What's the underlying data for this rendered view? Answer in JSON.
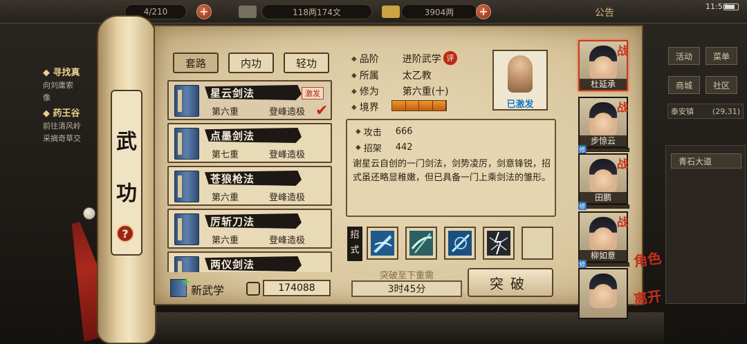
{
  "top_bar": {
    "gold_text": "118两174文",
    "silver_text": "3904两",
    "notice_label": "公告",
    "clock": "11:58",
    "stamina_text": "4/210"
  },
  "quests": [
    {
      "title": "寻找真",
      "lines": [
        "向刘庸索",
        "像"
      ]
    },
    {
      "title": "药王谷",
      "lines": [
        "前往清风岭",
        "采摘奇草交"
      ]
    }
  ],
  "side_menu": {
    "activity": "活动",
    "menu": "菜单",
    "mall": "商城",
    "community": "社区",
    "location": "泰安镇",
    "coords": "(29,31)",
    "road": "青石大道"
  },
  "scroll": {
    "title_char_1": "武",
    "title_char_2": "功",
    "help": "?"
  },
  "tabs": [
    {
      "label": "套路",
      "active": true
    },
    {
      "label": "内功",
      "active": false
    },
    {
      "label": "轻功",
      "active": false
    }
  ],
  "skills": [
    {
      "name": "星云剑法",
      "level": "第六重",
      "grade": "登峰造极",
      "badge": "激发",
      "selected": true
    },
    {
      "name": "点墨剑法",
      "level": "第七重",
      "grade": "登峰造极",
      "badge": "",
      "selected": false
    },
    {
      "name": "苍狼枪法",
      "level": "第六重",
      "grade": "登峰造极",
      "badge": "",
      "selected": false
    },
    {
      "name": "厉斩刀法",
      "level": "第六重",
      "grade": "登峰造极",
      "badge": "",
      "selected": false
    },
    {
      "name": "两仪剑法",
      "level": "",
      "grade": "",
      "badge": "",
      "selected": false
    }
  ],
  "bottom_left": {
    "new_skill": "新武学",
    "points": "174088"
  },
  "detail": {
    "grade_label": "品阶",
    "grade_value": "进阶武学",
    "grade_badge": "评",
    "sect_label": "所属",
    "sect_value": "太乙教",
    "level_label": "修为",
    "level_value": "第六重(十)",
    "realm_label": "境界",
    "realm_segments": 4,
    "status": "已激发",
    "attack_label": "攻击",
    "attack_value": "666",
    "parry_label": "招架",
    "parry_value": "442",
    "description": "谢星云自创的一门剑法，剑势凌厉，剑意锋锐，招式虽还略显稚嫩，但已具备一门上乘剑法的雏形。",
    "moves_label": "招式",
    "breakthrough_need": "突破至下重需",
    "breakthrough_time": "3时45分",
    "breakthrough_button": "突破"
  },
  "roster": [
    {
      "name": "杜延承",
      "selected": true,
      "cultivate": 0,
      "show_bar": false
    },
    {
      "name": "步惊云",
      "selected": false,
      "cultivate": 0.05,
      "show_bar": true
    },
    {
      "name": "田鹏",
      "selected": false,
      "cultivate": 0.05,
      "show_bar": true
    },
    {
      "name": "柳如意",
      "selected": false,
      "cultivate": 0.05,
      "show_bar": true
    },
    {
      "name": "",
      "selected": false,
      "cultivate": 0,
      "show_bar": false
    }
  ],
  "roster_icons": {
    "battle_glyph": "战",
    "cultivate_glyph": "修"
  },
  "right_actions": {
    "role": "角色",
    "leave": "离开"
  }
}
